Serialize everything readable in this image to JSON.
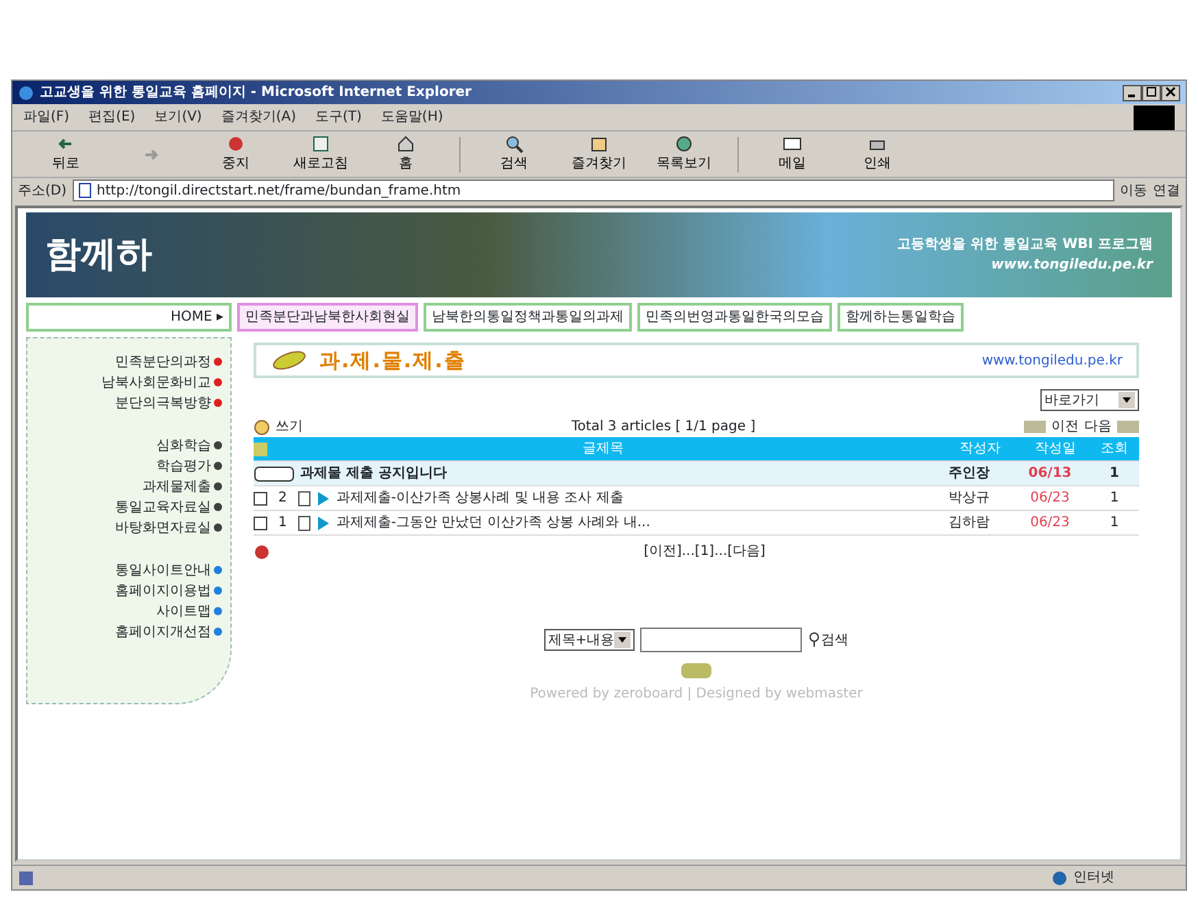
{
  "window": {
    "title": "고교생을 위한 통일교육 홈페이지 - Microsoft Internet Explorer"
  },
  "menu": [
    "파일(F)",
    "편집(E)",
    "보기(V)",
    "즐겨찾기(A)",
    "도구(T)",
    "도움말(H)"
  ],
  "toolbar": [
    {
      "label": "뒤로",
      "kind": "back"
    },
    {
      "kind": "forward"
    },
    {
      "label": "중지",
      "kind": "stop"
    },
    {
      "label": "새로고침",
      "kind": "refresh"
    },
    {
      "label": "홈",
      "kind": "home"
    },
    {
      "label": "검색",
      "kind": "search"
    },
    {
      "label": "즐겨찾기",
      "kind": "favorites"
    },
    {
      "label": "목록보기",
      "kind": "history"
    },
    {
      "label": "메일",
      "kind": "mail"
    },
    {
      "label": "인쇄",
      "kind": "print"
    }
  ],
  "address": {
    "label": "주소(D)",
    "url": "http://tongil.directstart.net/frame/bundan_frame.htm",
    "go": "이동",
    "links": "연결"
  },
  "banner": {
    "logo": "함께하",
    "slogan": "고등학생을 위한 통일교육 WBI 프로그램",
    "site": "www.tongiledu.pe.kr"
  },
  "nav": [
    {
      "label": "HOME ▸",
      "selected": false
    },
    {
      "label": "민족분단과남북한사회현실",
      "selected": true
    },
    {
      "label": "남북한의통일정책과통일의과제",
      "selected": false
    },
    {
      "label": "민족의번영과통일한국의모습",
      "selected": false
    },
    {
      "label": "함께하는통일학습",
      "selected": false
    }
  ],
  "sidebar": [
    {
      "label": "민족분단의과정",
      "color": "#e02020"
    },
    {
      "label": "남북사회문화비교",
      "color": "#e02020"
    },
    {
      "label": "분단의극복방향",
      "color": "#e02020"
    },
    {
      "label": "심화학습",
      "color": "#404040",
      "gap": true
    },
    {
      "label": "학습평가",
      "color": "#404040"
    },
    {
      "label": "과제물제출",
      "color": "#404040"
    },
    {
      "label": "통일교육자료실",
      "color": "#404040"
    },
    {
      "label": "바탕화면자료실",
      "color": "#404040"
    },
    {
      "label": "통일사이트안내",
      "color": "#2080e0",
      "gap": true
    },
    {
      "label": "홈페이지이용법",
      "color": "#2080e0"
    },
    {
      "label": "사이트맵",
      "color": "#2080e0"
    },
    {
      "label": "홈페이지개선점",
      "color": "#2080e0"
    }
  ],
  "board": {
    "title": "과.제.물.제.출",
    "site": "www.tongiledu.pe.kr",
    "jump": "바로가기",
    "write": "쓰기",
    "total": "Total 3 articles [ 1/1 page ]",
    "prev": "이전",
    "next": "다음",
    "columns": [
      "글제목",
      "작성자",
      "작성일",
      "조회"
    ],
    "rows": [
      {
        "kind": "notice",
        "title": "과제물 제출 공지입니다",
        "author": "주인장",
        "date": "06/13",
        "views": "1"
      },
      {
        "kind": "post",
        "number": "2",
        "title": "과제제출-이산가족 상봉사례 및 내용 조사 제출",
        "author": "박상규",
        "date": "06/23",
        "views": "1",
        "checked": false
      },
      {
        "kind": "post",
        "number": "1",
        "title": "과제제출-그동안 만났던 이산가족 상봉 사례와 내...",
        "author": "김하람",
        "date": "06/23",
        "views": "1",
        "checked": false
      }
    ],
    "pager": "[이전]...[1]...[다음]",
    "search_scope": "제목+내용",
    "search_button": "검색",
    "footer": "Powered by zeroboard | Designed by webmaster"
  },
  "status_bar": {
    "zone": "인터넷"
  }
}
